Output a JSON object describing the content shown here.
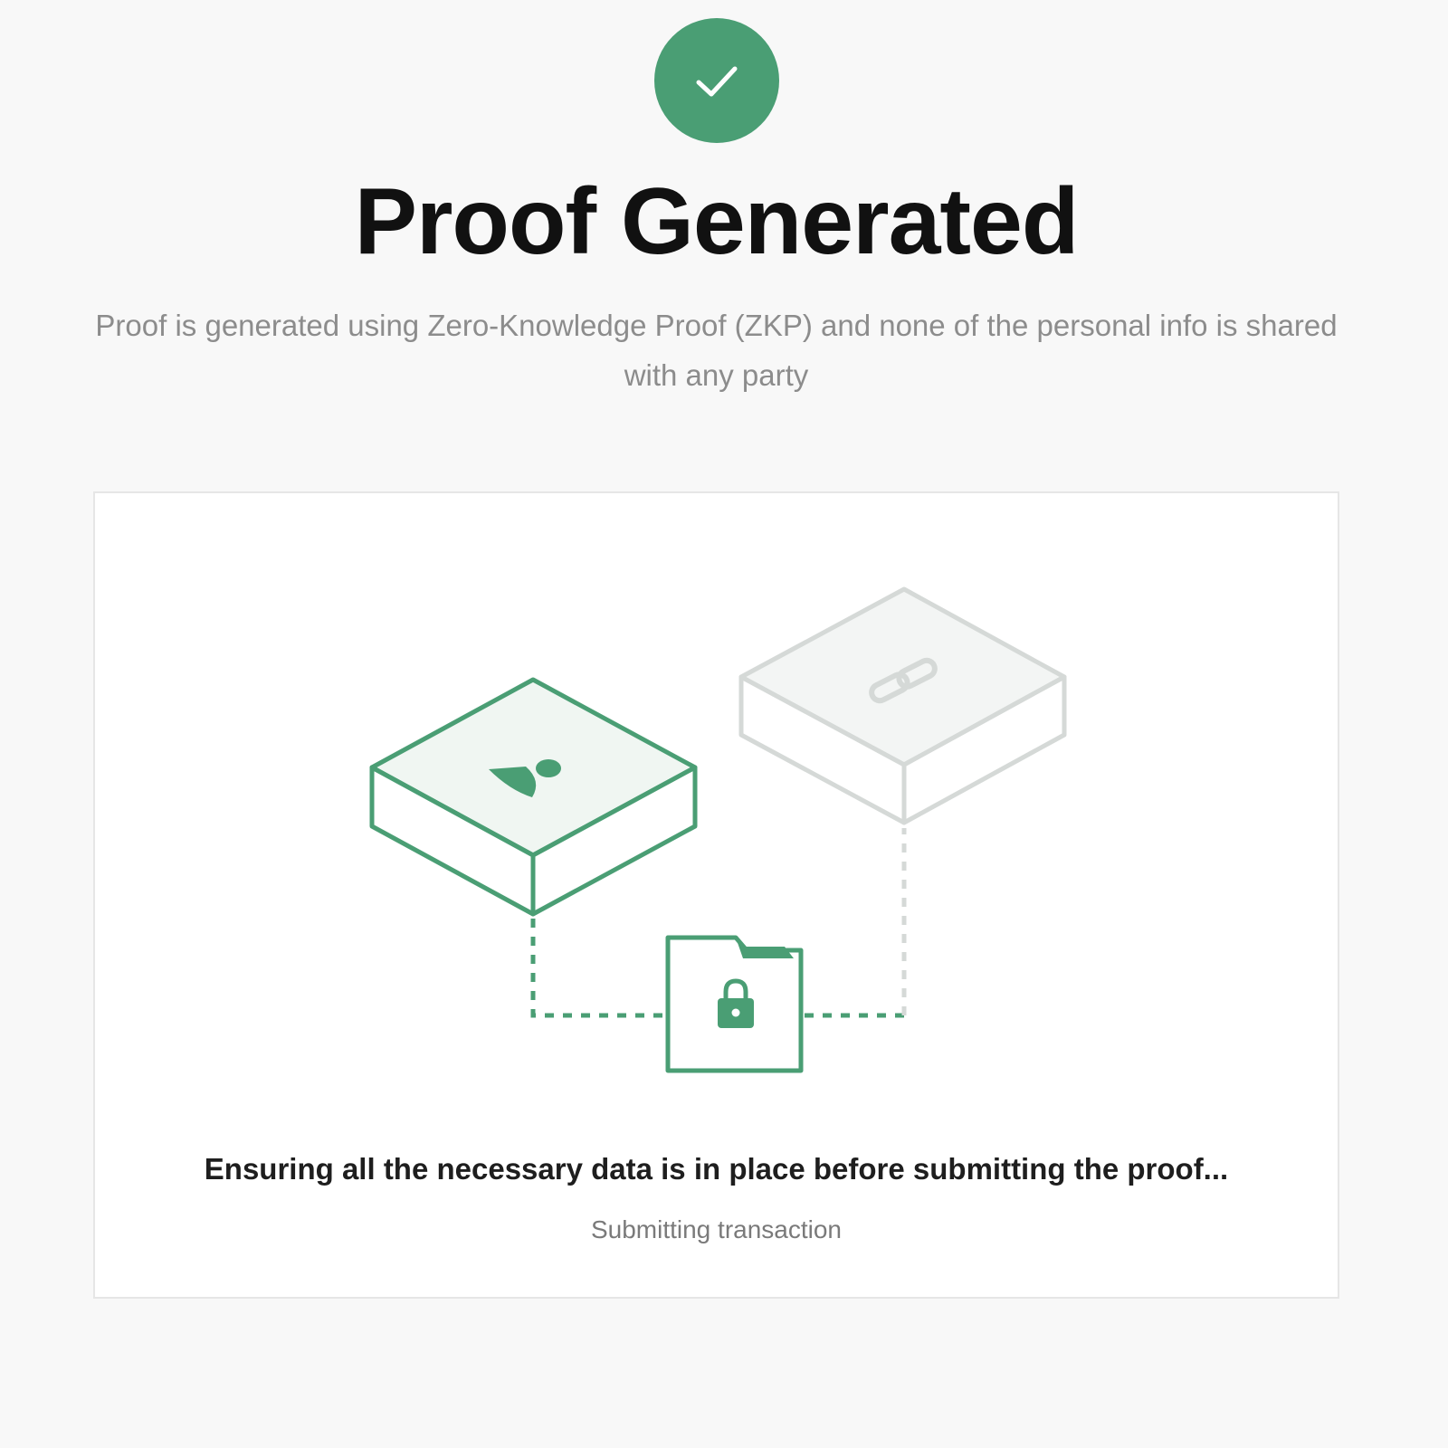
{
  "header": {
    "title": "Proof Generated",
    "description": "Proof is generated using Zero-Knowledge Proof (ZKP) and none of the personal info is shared with any party"
  },
  "status": {
    "message": "Ensuring all the necessary data is in place before submitting the proof...",
    "step": "Submitting transaction"
  },
  "illustration": {
    "icons": [
      "checkmark-icon",
      "user-icon",
      "link-icon",
      "lock-icon",
      "folder-icon"
    ]
  },
  "colors": {
    "accent": "#4a9e74",
    "accent_tint": "#f0f6f2",
    "muted_box": "#d5d9d7",
    "muted_tint": "#f3f5f4",
    "background": "#f8f8f8",
    "card": "#ffffff"
  }
}
